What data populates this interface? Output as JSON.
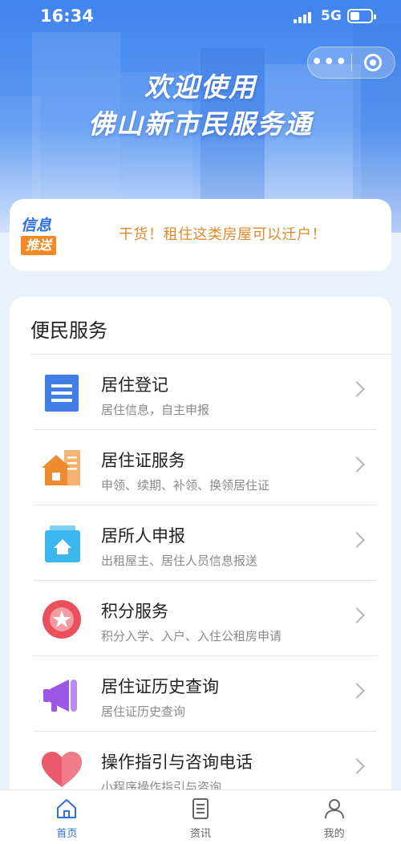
{
  "status_bar": {
    "time": "16:34",
    "network": "5G"
  },
  "header": {
    "welcome_line1": "欢迎使用",
    "welcome_line2": "佛山新市民服务通"
  },
  "capsule": {
    "more_label": "•••"
  },
  "notice": {
    "badge_top": "信息",
    "badge_bottom": "推送",
    "text": "干货！租住这类房屋可以迁户！"
  },
  "services": {
    "title": "便民服务",
    "items": [
      {
        "title": "居住登记",
        "subtitle": "居住信息，自主申报",
        "icon": "document-list-icon",
        "color": "#3f7fe6"
      },
      {
        "title": "居住证服务",
        "subtitle": "申领、续期、补领、换领居住证",
        "icon": "house-icon",
        "color": "#f0963a"
      },
      {
        "title": "居所人申报",
        "subtitle": "出租屋主、居住人员信息报送",
        "icon": "home-upload-icon",
        "color": "#3cb7ee"
      },
      {
        "title": "积分服务",
        "subtitle": "积分入学、入户、入住公租房申请",
        "icon": "star-badge-icon",
        "color": "#e9505c"
      },
      {
        "title": "居住证历史查询",
        "subtitle": "居住证历史查询",
        "icon": "megaphone-icon",
        "color": "#9b56e6"
      },
      {
        "title": "操作指引与咨询电话",
        "subtitle": "小程序操作指引与咨询",
        "icon": "heart-icon",
        "color": "#ea5a6a"
      }
    ]
  },
  "tabbar": {
    "tabs": [
      {
        "label": "首页",
        "icon": "home-icon",
        "active": true
      },
      {
        "label": "资讯",
        "icon": "news-icon",
        "active": false
      },
      {
        "label": "我的",
        "icon": "user-icon",
        "active": false
      }
    ],
    "active_color": "#2f6fe0"
  }
}
